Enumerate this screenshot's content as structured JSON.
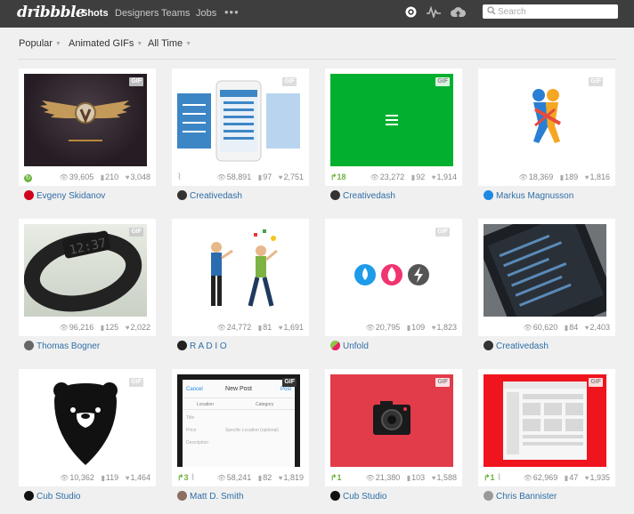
{
  "topbar": {
    "logo": "dribbble",
    "nav": [
      "Shots",
      "Designers",
      "Teams",
      "Jobs"
    ],
    "more": "•••",
    "search_placeholder": "Search",
    "icons": [
      "dribbble-ball-icon",
      "activity-icon",
      "cloud-upload-icon"
    ],
    "bg_color": "#3e3e3e"
  },
  "filters": {
    "sort": "Popular",
    "list": "Animated GIFs",
    "timeframe": "All Time"
  },
  "shots": [
    {
      "author": "Evgeny Skidanov",
      "views": "39,605",
      "comments": "210",
      "likes": "3,048",
      "rebounds": "",
      "attach": false,
      "gif": true,
      "avatar_color": "#d0021b",
      "rebound_icon": true
    },
    {
      "author": "Creativedash",
      "views": "58,891",
      "comments": "97",
      "likes": "2,751",
      "rebounds": "",
      "attach": true,
      "gif": true,
      "avatar_color": "#333333",
      "rebound_icon": false
    },
    {
      "author": "Creativedash",
      "views": "23,272",
      "comments": "92",
      "likes": "1,914",
      "rebounds": "18",
      "attach": false,
      "gif": true,
      "avatar_color": "#333333",
      "rebound_icon": false
    },
    {
      "author": "Markus Magnusson",
      "views": "18,369",
      "comments": "189",
      "likes": "1,816",
      "rebounds": "",
      "attach": false,
      "gif": true,
      "avatar_color": "#1e88e5",
      "rebound_icon": false
    },
    {
      "author": "Thomas Bogner",
      "views": "96,216",
      "comments": "125",
      "likes": "2,022",
      "rebounds": "",
      "attach": false,
      "gif": true,
      "avatar_color": "#666666",
      "rebound_icon": false
    },
    {
      "author": "R A D I O",
      "views": "24,772",
      "comments": "81",
      "likes": "1,691",
      "rebounds": "",
      "attach": false,
      "gif": true,
      "avatar_color": "#222222",
      "rebound_icon": false
    },
    {
      "author": "Unfold",
      "views": "20,795",
      "comments": "109",
      "likes": "1,823",
      "rebounds": "",
      "attach": false,
      "gif": true,
      "avatar_color": "#8bc34a",
      "rebound_icon": false
    },
    {
      "author": "Creativedash",
      "views": "60,620",
      "comments": "84",
      "likes": "2,403",
      "rebounds": "",
      "attach": false,
      "gif": true,
      "avatar_color": "#333333",
      "rebound_icon": false
    },
    {
      "author": "Cub Studio",
      "views": "10,362",
      "comments": "119",
      "likes": "1,464",
      "rebounds": "",
      "attach": false,
      "gif": true,
      "avatar_color": "#111111",
      "rebound_icon": false
    },
    {
      "author": "Matt D. Smith",
      "views": "58,241",
      "comments": "82",
      "likes": "1,819",
      "rebounds": "3",
      "attach": true,
      "gif": true,
      "avatar_color": "#8d6e63",
      "rebound_icon": false
    },
    {
      "author": "Cub Studio",
      "views": "21,380",
      "comments": "103",
      "likes": "1,588",
      "rebounds": "1",
      "attach": false,
      "gif": true,
      "avatar_color": "#111111",
      "rebound_icon": false
    },
    {
      "author": "Chris Bannister",
      "views": "62,969",
      "comments": "47",
      "likes": "1,935",
      "rebounds": "1",
      "attach": true,
      "gif": true,
      "avatar_color": "#999999",
      "rebound_icon": false
    }
  ],
  "thumb_text": {
    "new_post": "New Post",
    "location": "Location",
    "category": "Category",
    "title": "Title",
    "price": "Price",
    "specific_location": "Specific Location (optional)",
    "description": "Description",
    "cancel": "Cancel",
    "post": "Post"
  }
}
